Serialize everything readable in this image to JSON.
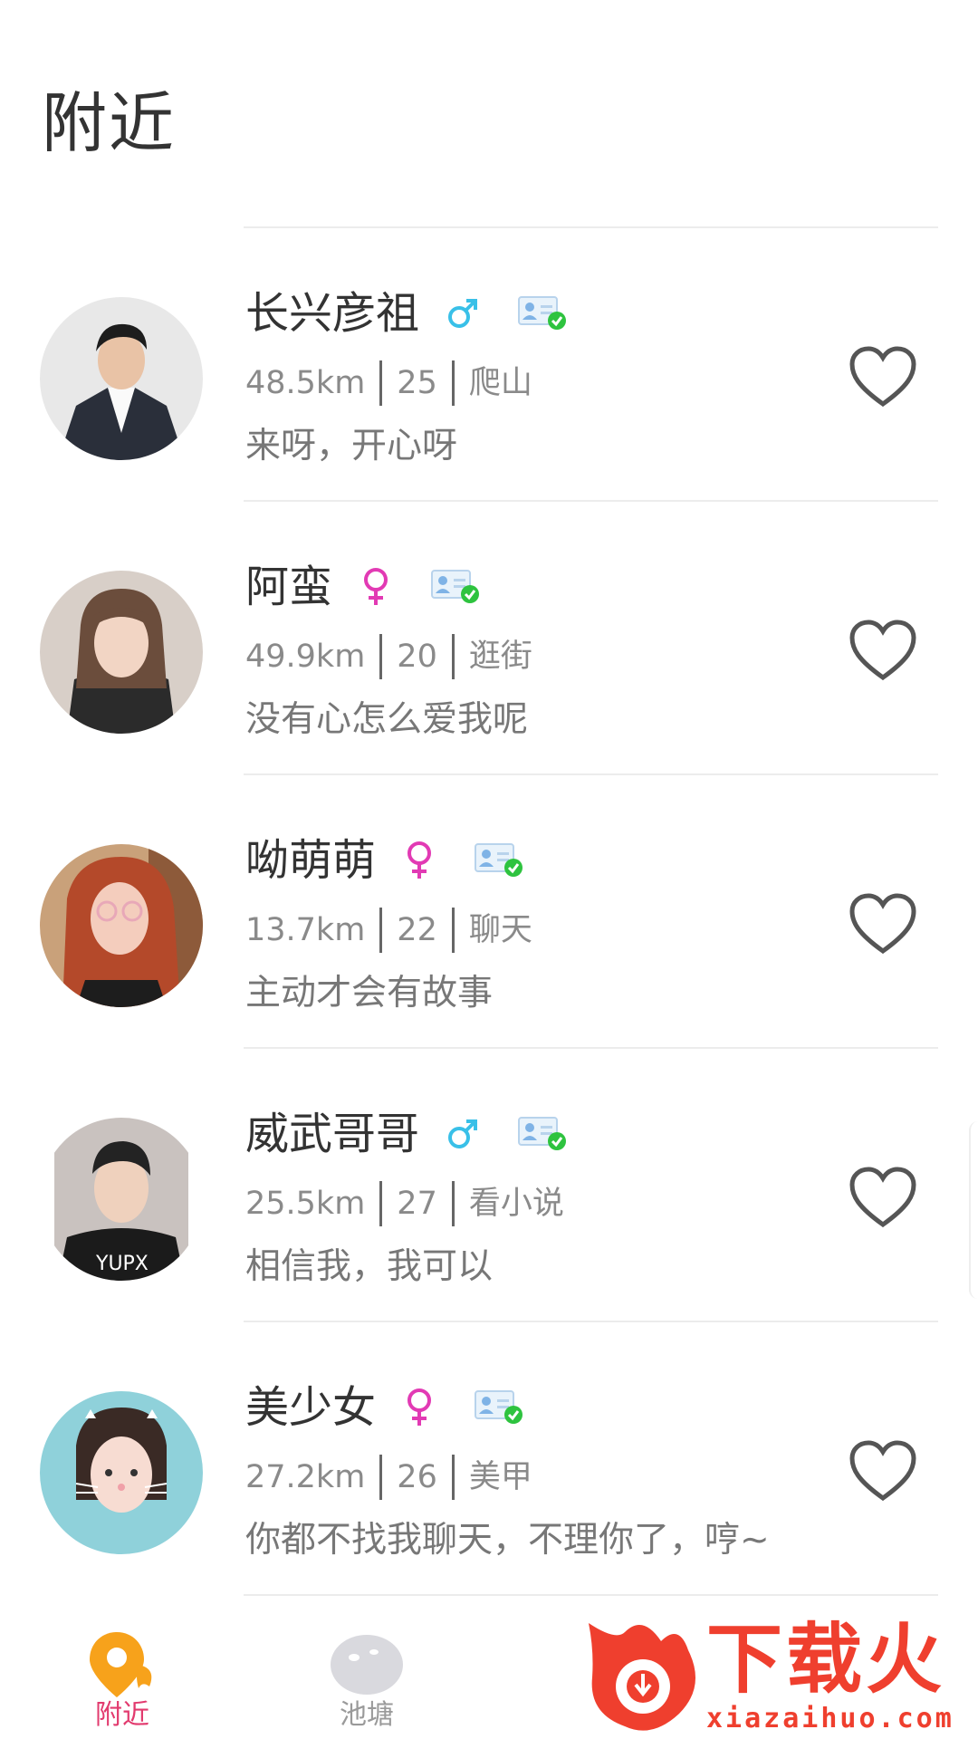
{
  "page_title": "附近",
  "users": [
    {
      "name": "长兴彦祖",
      "gender": "male",
      "distance": "48.5km",
      "age": "25",
      "hobby": "爬山",
      "bio": "来呀，开心呀"
    },
    {
      "name": "阿蛮",
      "gender": "female",
      "distance": "49.9km",
      "age": "20",
      "hobby": "逛街",
      "bio": "没有心怎么爱我呢"
    },
    {
      "name": "呦萌萌",
      "gender": "female",
      "distance": "13.7km",
      "age": "22",
      "hobby": "聊天",
      "bio": "主动才会有故事"
    },
    {
      "name": "威武哥哥",
      "gender": "male",
      "distance": "25.5km",
      "age": "27",
      "hobby": "看小说",
      "bio": "相信我，我可以"
    },
    {
      "name": "美少女",
      "gender": "female",
      "distance": "27.2km",
      "age": "26",
      "hobby": "美甲",
      "bio": "你都不找我聊天，不理你了，哼~"
    }
  ],
  "tabbar": {
    "tabs": [
      {
        "label": "附近",
        "icon": "location-pin-icon",
        "active": true
      },
      {
        "label": "池塘",
        "icon": "pond-icon",
        "active": false
      }
    ]
  },
  "watermark": {
    "text": "下载火",
    "sub": "xiazaihuo.com"
  },
  "colors": {
    "male": "#39c0e8",
    "female": "#e23ab4",
    "active_tab": "#e23a6e",
    "accent_orange": "#f7a21b",
    "verify_green": "#2ec33f"
  }
}
